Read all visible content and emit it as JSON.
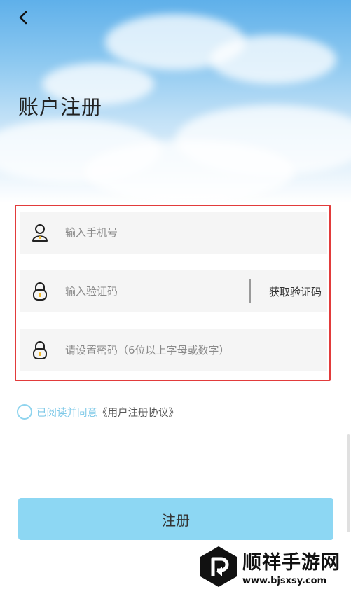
{
  "header": {
    "back_icon": "chevron-left-icon",
    "title": "账户注册"
  },
  "form": {
    "phone": {
      "icon": "user-icon",
      "placeholder": "输入手机号",
      "value": ""
    },
    "code": {
      "icon": "lock-icon",
      "placeholder": "输入验证码",
      "value": "",
      "action_label": "获取验证码"
    },
    "password": {
      "icon": "lock-icon",
      "placeholder": "请设置密码（6位以上字母或数字）",
      "value": ""
    },
    "highlight_color": "#e23b3b"
  },
  "agreement": {
    "checked": false,
    "text": "已阅读并同意",
    "link": "《用户注册协议》"
  },
  "submit": {
    "label": "注册",
    "color": "#8dd7f3"
  },
  "watermark": {
    "title": "顺祥手游网",
    "url": "www.bjsxsy.com"
  }
}
